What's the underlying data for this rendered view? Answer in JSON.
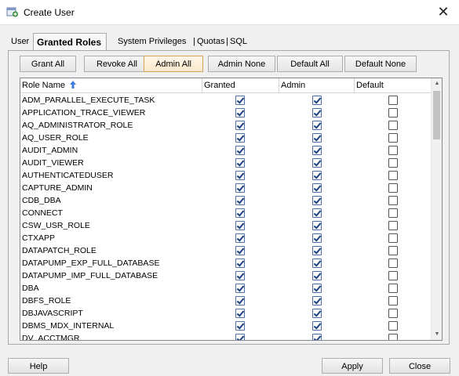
{
  "window": {
    "title": "Create User",
    "close_glyph": "✕"
  },
  "tabs": [
    {
      "label": "User",
      "active": false
    },
    {
      "label": "Granted Roles",
      "active": true
    },
    {
      "label": "System Privileges",
      "active": false
    },
    {
      "label": "Quotas",
      "active": false
    },
    {
      "label": "SQL",
      "active": false
    }
  ],
  "tab_separator": "|",
  "toolbar": {
    "grant_all": "Grant All",
    "revoke_all": "Revoke All",
    "admin_all": "Admin All",
    "admin_none": "Admin None",
    "default_all": "Default All",
    "default_none": "Default None"
  },
  "table": {
    "columns": [
      "Role Name",
      "Granted",
      "Admin",
      "Default"
    ],
    "rows": [
      {
        "name": "ADM_PARALLEL_EXECUTE_TASK",
        "granted": true,
        "admin": true,
        "default": false
      },
      {
        "name": "APPLICATION_TRACE_VIEWER",
        "granted": true,
        "admin": true,
        "default": false
      },
      {
        "name": "AQ_ADMINISTRATOR_ROLE",
        "granted": true,
        "admin": true,
        "default": false
      },
      {
        "name": "AQ_USER_ROLE",
        "granted": true,
        "admin": true,
        "default": false
      },
      {
        "name": "AUDIT_ADMIN",
        "granted": true,
        "admin": true,
        "default": false
      },
      {
        "name": "AUDIT_VIEWER",
        "granted": true,
        "admin": true,
        "default": false
      },
      {
        "name": "AUTHENTICATEDUSER",
        "granted": true,
        "admin": true,
        "default": false
      },
      {
        "name": "CAPTURE_ADMIN",
        "granted": true,
        "admin": true,
        "default": false
      },
      {
        "name": "CDB_DBA",
        "granted": true,
        "admin": true,
        "default": false
      },
      {
        "name": "CONNECT",
        "granted": true,
        "admin": true,
        "default": false
      },
      {
        "name": "CSW_USR_ROLE",
        "granted": true,
        "admin": true,
        "default": false
      },
      {
        "name": "CTXAPP",
        "granted": true,
        "admin": true,
        "default": false
      },
      {
        "name": "DATAPATCH_ROLE",
        "granted": true,
        "admin": true,
        "default": false
      },
      {
        "name": "DATAPUMP_EXP_FULL_DATABASE",
        "granted": true,
        "admin": true,
        "default": false
      },
      {
        "name": "DATAPUMP_IMP_FULL_DATABASE",
        "granted": true,
        "admin": true,
        "default": false
      },
      {
        "name": "DBA",
        "granted": true,
        "admin": true,
        "default": false
      },
      {
        "name": "DBFS_ROLE",
        "granted": true,
        "admin": true,
        "default": false
      },
      {
        "name": "DBJAVASCRIPT",
        "granted": true,
        "admin": true,
        "default": false
      },
      {
        "name": "DBMS_MDX_INTERNAL",
        "granted": true,
        "admin": true,
        "default": false
      },
      {
        "name": "DV_ACCTMGR",
        "granted": true,
        "admin": true,
        "default": false
      }
    ]
  },
  "footer": {
    "help": "Help",
    "apply": "Apply",
    "close": "Close"
  },
  "colors": {
    "focus_border": "#d9a25a",
    "checkmark": "#1e3f84",
    "sort_arrow": "#3b7ddd"
  }
}
